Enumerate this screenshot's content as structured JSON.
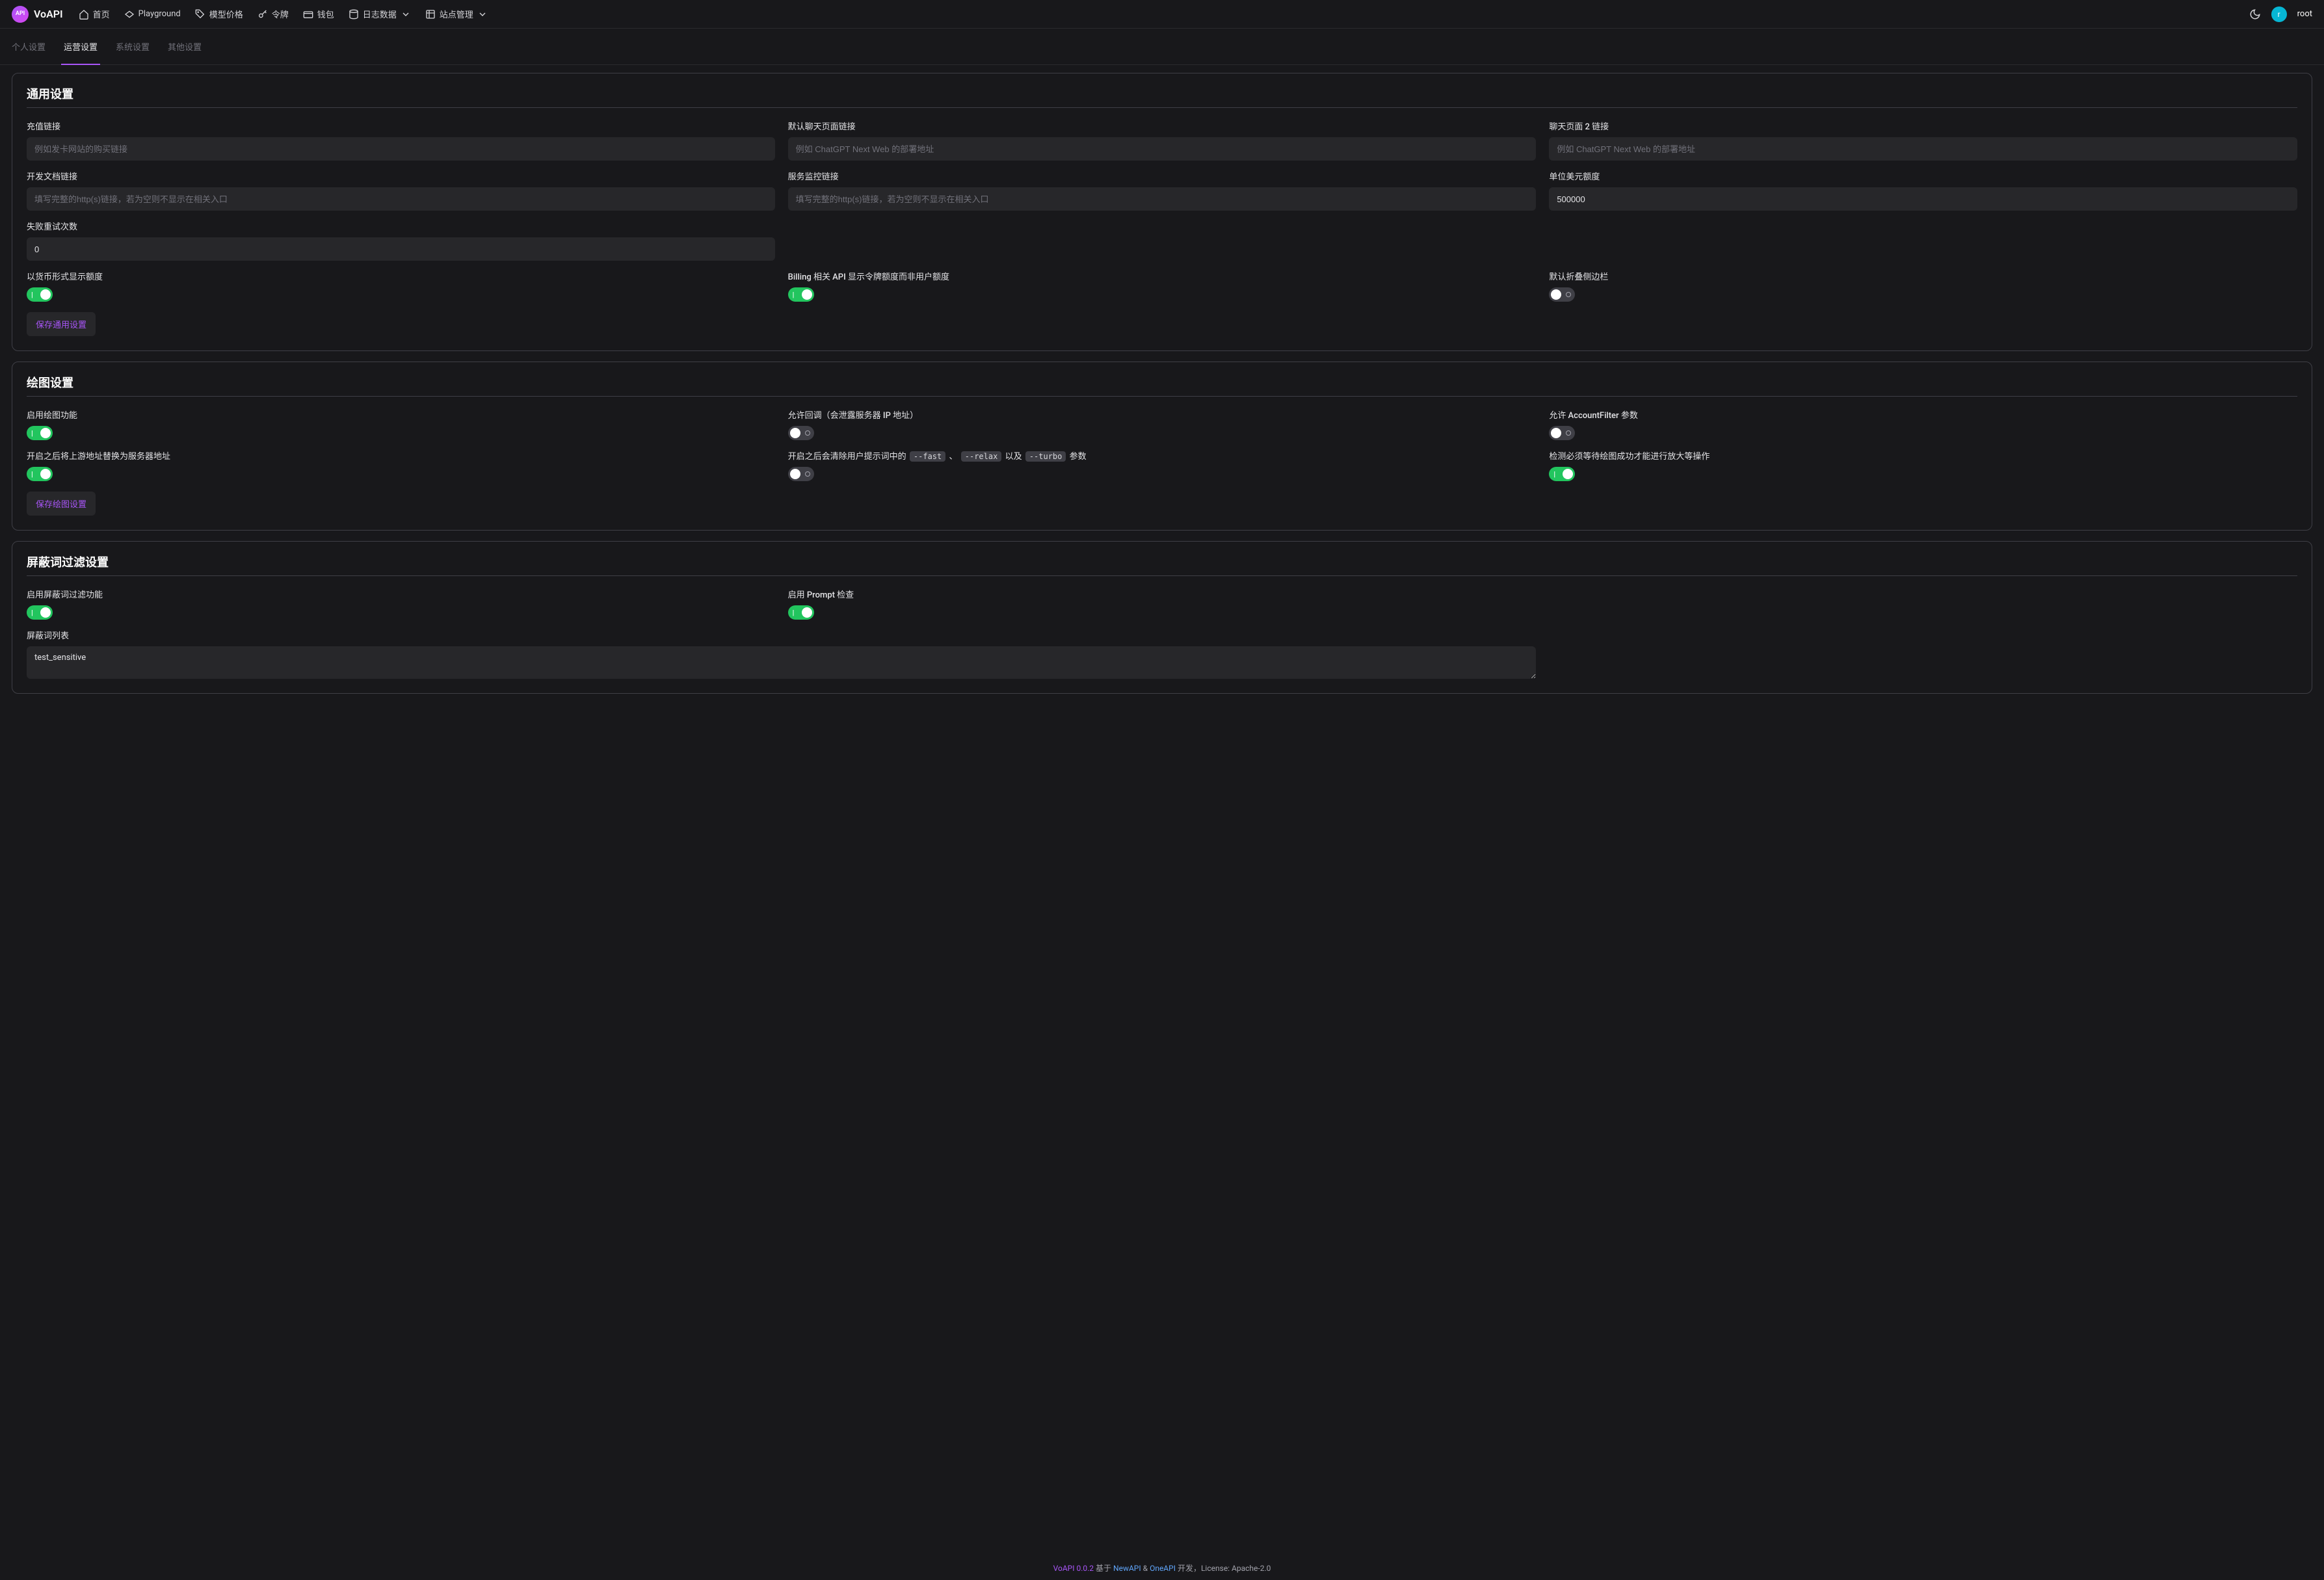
{
  "brand": {
    "logo_text": "VoAPI",
    "logo_glyph": "API\nVo"
  },
  "nav": {
    "home": "首页",
    "playground": "Playground",
    "pricing": "模型价格",
    "token": "令牌",
    "wallet": "钱包",
    "logs": "日志数据",
    "site": "站点管理"
  },
  "user": {
    "initial": "r",
    "name": "root"
  },
  "tabs": {
    "personal": "个人设置",
    "ops": "运营设置",
    "system": "系统设置",
    "other": "其他设置"
  },
  "general": {
    "title": "通用设置",
    "recharge_link": {
      "label": "充值链接",
      "placeholder": "例如发卡网站的购买链接",
      "value": ""
    },
    "chat_link": {
      "label": "默认聊天页面链接",
      "placeholder": "例如 ChatGPT Next Web 的部署地址",
      "value": ""
    },
    "chat_link2": {
      "label": "聊天页面 2 链接",
      "placeholder": "例如 ChatGPT Next Web 的部署地址",
      "value": ""
    },
    "docs_link": {
      "label": "开发文档链接",
      "placeholder": "填写完整的http(s)链接，若为空则不显示在相关入口",
      "value": ""
    },
    "monitor_link": {
      "label": "服务监控链接",
      "placeholder": "填写完整的http(s)链接，若为空则不显示在相关入口",
      "value": ""
    },
    "usd_quota": {
      "label": "单位美元额度",
      "value": "500000"
    },
    "retry": {
      "label": "失败重试次数",
      "value": "0"
    },
    "show_currency": {
      "label": "以货币形式显示额度",
      "on": true
    },
    "billing_token": {
      "label": "Billing 相关 API 显示令牌额度而非用户额度",
      "on": true
    },
    "collapse_sidebar": {
      "label": "默认折叠侧边栏",
      "on": false
    },
    "save": "保存通用设置"
  },
  "draw": {
    "title": "绘图设置",
    "enable": {
      "label": "启用绘图功能",
      "on": true
    },
    "callback": {
      "label": "允许回调（会泄露服务器 IP 地址）",
      "on": false
    },
    "account_filter": {
      "label": "允许 AccountFilter 参数",
      "on": false
    },
    "replace_upstream": {
      "label": "开启之后将上游地址替换为服务器地址",
      "on": true
    },
    "strip_flags": {
      "prefix": "开启之后会清除用户提示词中的",
      "fast": "--fast",
      "sep1": "、",
      "relax": "--relax",
      "mid": "以及",
      "turbo": "--turbo",
      "suffix": "参数",
      "on": false
    },
    "detect_success": {
      "label": "检测必须等待绘图成功才能进行放大等操作",
      "on": true
    },
    "save": "保存绘图设置"
  },
  "filter": {
    "title": "屏蔽词过滤设置",
    "enable": {
      "label": "启用屏蔽词过滤功能",
      "on": true
    },
    "prompt_check": {
      "label": "启用 Prompt 检查",
      "on": true
    },
    "list": {
      "label": "屏蔽词列表",
      "value": "test_sensitive"
    }
  },
  "footer": {
    "brand": "VoAPI 0.0.2",
    "based_on": "基于",
    "newapi": "NewAPI",
    "and": "&",
    "oneapi": "OneAPI",
    "dev": "开发，License: Apache-2.0"
  }
}
